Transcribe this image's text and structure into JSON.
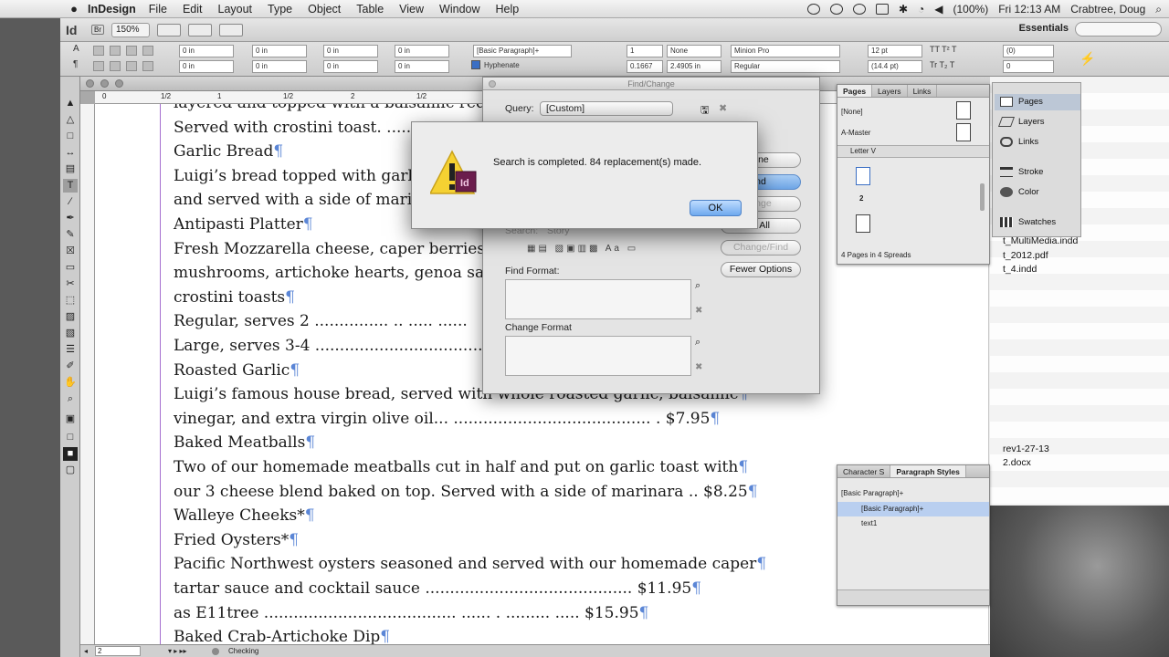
{
  "menubar": {
    "apple": "",
    "app_name": "InDesign",
    "items": [
      "File",
      "Edit",
      "Layout",
      "Type",
      "Object",
      "Table",
      "View",
      "Window",
      "Help"
    ],
    "battery": "(100%)",
    "clock": "Fri 12:13 AM",
    "user": "Crabtree, Doug"
  },
  "appbar": {
    "logo": "Id",
    "bridge": "Br",
    "zoom": "150%",
    "workspace": "Essentials"
  },
  "control": {
    "indent_left": "0 in",
    "indent_right": "0 in",
    "indent_first": "0 in",
    "indent_last": "0 in",
    "space_before": "0 in",
    "space_after": "0 in",
    "paragraph_style": "[Basic Paragraph]+",
    "hyphenate": "Hyphenate",
    "drop_lines": "1",
    "drop_chars": "0.1667",
    "drop_none": "None",
    "drop_value": "2.4905 in",
    "font": "Minion Pro",
    "font_style": "Regular",
    "size": "12 pt",
    "leading": "(14.4 pt)",
    "tracking": "(0)",
    "kerning": "0"
  },
  "document": {
    "lines": [
      {
        "text": "layered and topped with a balsamic reduction",
        "pil": false
      },
      {
        "text": "Served with crostini toast. ........",
        "pil": false
      },
      {
        "text": "Garlic Bread",
        "pil": true
      },
      {
        "text": "Luigi’s bread topped with garlic",
        "pil": false
      },
      {
        "text": "and served with a side of marin",
        "pil": false
      },
      {
        "text": "Antipasti Platter",
        "pil": true
      },
      {
        "text": "Fresh Mozzarella cheese, caper berries, r",
        "pil": false
      },
      {
        "text": "mushrooms, artichoke hearts, genoa sala",
        "pil": false
      },
      {
        "text": "crostini toasts",
        "pil": true
      },
      {
        "text": "Regular, serves 2 ............... .. ..... ......",
        "pil": false
      },
      {
        "text": "Large, serves 3-4 ..........................................",
        "pil": false
      },
      {
        "text": "Roasted Garlic",
        "pil": true
      },
      {
        "text": "Luigi’s famous house bread, served with whole roasted garlic, balsamic",
        "pil": true
      },
      {
        "text": "vinegar, and extra virgin olive oil... ........................................ . $7.95",
        "pil": true
      },
      {
        "text": "Baked Meatballs",
        "pil": true
      },
      {
        "text": "Two of our homemade meatballs cut in half and put on garlic toast with",
        "pil": true
      },
      {
        "text": "our 3 cheese blend baked on top. Served with a side of marinara .. $8.25",
        "pil": true
      },
      {
        "text": "Walleye Cheeks*",
        "pil": true
      },
      {
        "text": "Fried Oysters*",
        "pil": true
      },
      {
        "text": "Pacific Northwest oysters seasoned and served with our homemade caper",
        "pil": true
      },
      {
        "text": "tartar sauce and cocktail sauce .......................................... $11.95",
        "pil": true
      },
      {
        "text": "as E11tree ....................................... ...... . ......... ..... $15.95",
        "pil": true
      },
      {
        "text": "Baked Crab-Artichoke Dip",
        "pil": true
      }
    ],
    "pilcrow": "¶",
    "status_page": "2",
    "status_preflight": "Checking"
  },
  "findchange": {
    "title": "Find/Change",
    "query_label": "Query:",
    "query_value": "[Custom]",
    "search_label": "Search:",
    "search_value": "Story",
    "btn_done": "one",
    "btn_find": "nd",
    "btn_change": "ange",
    "btn_change_all": "e All",
    "btn_change_find": "Change/Find",
    "btn_fewer": "Fewer Options",
    "find_format": "Find Format:",
    "change_format": "Change Format"
  },
  "alert": {
    "message": "Search is completed.  84 replacement(s) made.",
    "ok": "OK",
    "icon_badge": "Id"
  },
  "pages_panel": {
    "tabs": [
      "Pages",
      "Layers",
      "Links"
    ],
    "none": "[None]",
    "master": "A-Master",
    "layout": "Letter V",
    "page_number": "2",
    "footer": "4 Pages in 4 Spreads"
  },
  "dock": {
    "items": [
      "Pages",
      "Layers",
      "Links",
      "Stroke",
      "Color",
      "Swatches"
    ]
  },
  "finder": {
    "files": [
      "t_MultiMedia.indd",
      "t_2012.pdf",
      "t_4.indd",
      "rev1-27-13",
      "2.docx"
    ]
  },
  "para_styles": {
    "tabs": [
      "Character S",
      "Paragraph Styles"
    ],
    "current": "[Basic Paragraph]+",
    "rows": [
      "[Basic Paragraph]+",
      "text1"
    ]
  },
  "colors": {
    "margin_guide": "#a56fd0",
    "pilcrow": "#5b86d6",
    "selection": "#b9cff0",
    "default_button": "#6fa9ee"
  }
}
